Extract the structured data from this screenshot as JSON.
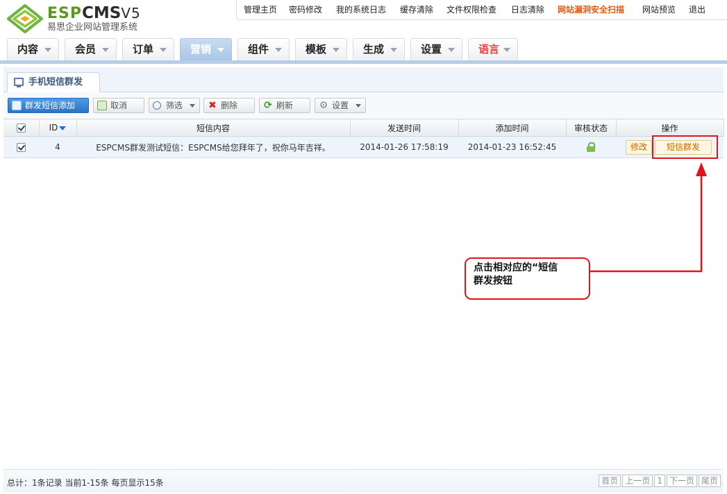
{
  "app": {
    "brand": "ESP",
    "brand_cms": "CMS",
    "brand_version": "V5",
    "subtitle": "易思企业网站管理系统"
  },
  "topnav": [
    {
      "label": "管理主页"
    },
    {
      "label": "密码修改"
    },
    {
      "label": "我的系统日志"
    },
    {
      "label": "缓存清除"
    },
    {
      "label": "文件权限检查"
    },
    {
      "label": "日志清除"
    },
    {
      "label": "网站漏洞安全扫描",
      "highlight": true
    },
    {
      "label": "网站预览"
    },
    {
      "label": "退出"
    }
  ],
  "mainnav": [
    {
      "label": "内容"
    },
    {
      "label": "会员"
    },
    {
      "label": "订单"
    },
    {
      "label": "营销",
      "active": true
    },
    {
      "label": "组件"
    },
    {
      "label": "模板"
    },
    {
      "label": "生成"
    },
    {
      "label": "设置"
    },
    {
      "label": "语言",
      "accent": true
    }
  ],
  "subtab": {
    "label": "手机短信群发"
  },
  "toolbar": {
    "add": "群发短信添加",
    "cancel": "取消",
    "filter": "筛选",
    "delete": "删除",
    "refresh": "刷新",
    "settings": "设置"
  },
  "table": {
    "headers": {
      "id": "ID",
      "content": "短信内容",
      "send_time": "发送时间",
      "add_time": "添加时间",
      "status": "审核状态",
      "actions": "操作"
    },
    "rows": [
      {
        "id": "4",
        "content": "ESPCMS群发测试短信：ESPCMS给您拜年了，祝你马年吉祥。",
        "send_time": "2014-01-26 17:58:19",
        "add_time": "2014-01-23 16:52:45",
        "edit": "修改",
        "sms": "短信群发"
      }
    ]
  },
  "annotation": {
    "line1": "点击相对应的“短信",
    "line2": "群发按钮"
  },
  "footer": {
    "summary": "总计：1条记录 当前1-15条 每页显示15条",
    "first": "首页",
    "prev": "上一页",
    "page": "1",
    "next": "下一页",
    "last": "尾页"
  },
  "colors": {
    "accent_blue": "#2a74c8",
    "highlight_red": "#e0141c",
    "danger_orange": "#e45a0e",
    "brand_green": "#5a9a1e"
  }
}
